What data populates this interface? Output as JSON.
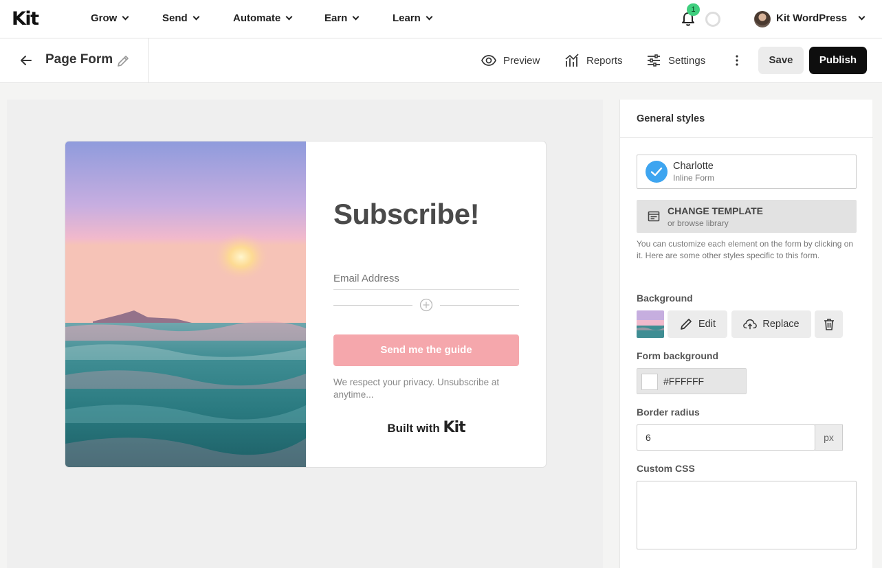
{
  "brand": {
    "logo_text": "Kit"
  },
  "nav": {
    "items": [
      {
        "label": "Grow"
      },
      {
        "label": "Send"
      },
      {
        "label": "Automate"
      },
      {
        "label": "Earn"
      },
      {
        "label": "Learn"
      }
    ],
    "notification_count": "1",
    "account_name": "Kit WordPress"
  },
  "toolbar": {
    "page_title": "Page Form",
    "preview_label": "Preview",
    "reports_label": "Reports",
    "settings_label": "Settings",
    "save_label": "Save",
    "publish_label": "Publish"
  },
  "form_preview": {
    "headline": "Subscribe!",
    "email_placeholder": "Email Address",
    "submit_label": "Send me the guide",
    "privacy_text": "We respect your privacy. Unsubscribe at anytime...",
    "built_with": "Built with",
    "built_with_brand": "Kit",
    "button_color": "#f5a7ac"
  },
  "panel": {
    "title": "General styles",
    "template_name": "Charlotte",
    "template_type": "Inline Form",
    "change_template": "CHANGE TEMPLATE",
    "change_template_sub": "or browse library",
    "help_text": "You can customize each element on the form by clicking on it. Here are some other styles specific to this form.",
    "background_label": "Background",
    "edit_label": "Edit",
    "replace_label": "Replace",
    "form_background_label": "Form background",
    "form_background_value": "#FFFFFF",
    "border_radius_label": "Border radius",
    "border_radius_value": "6",
    "border_radius_unit": "px",
    "custom_css_label": "Custom CSS",
    "custom_css_value": ""
  },
  "colors": {
    "accent_blue": "#3ea5f0",
    "publish_bg": "#0e0e0e",
    "badge_green": "#3fcf7e"
  }
}
